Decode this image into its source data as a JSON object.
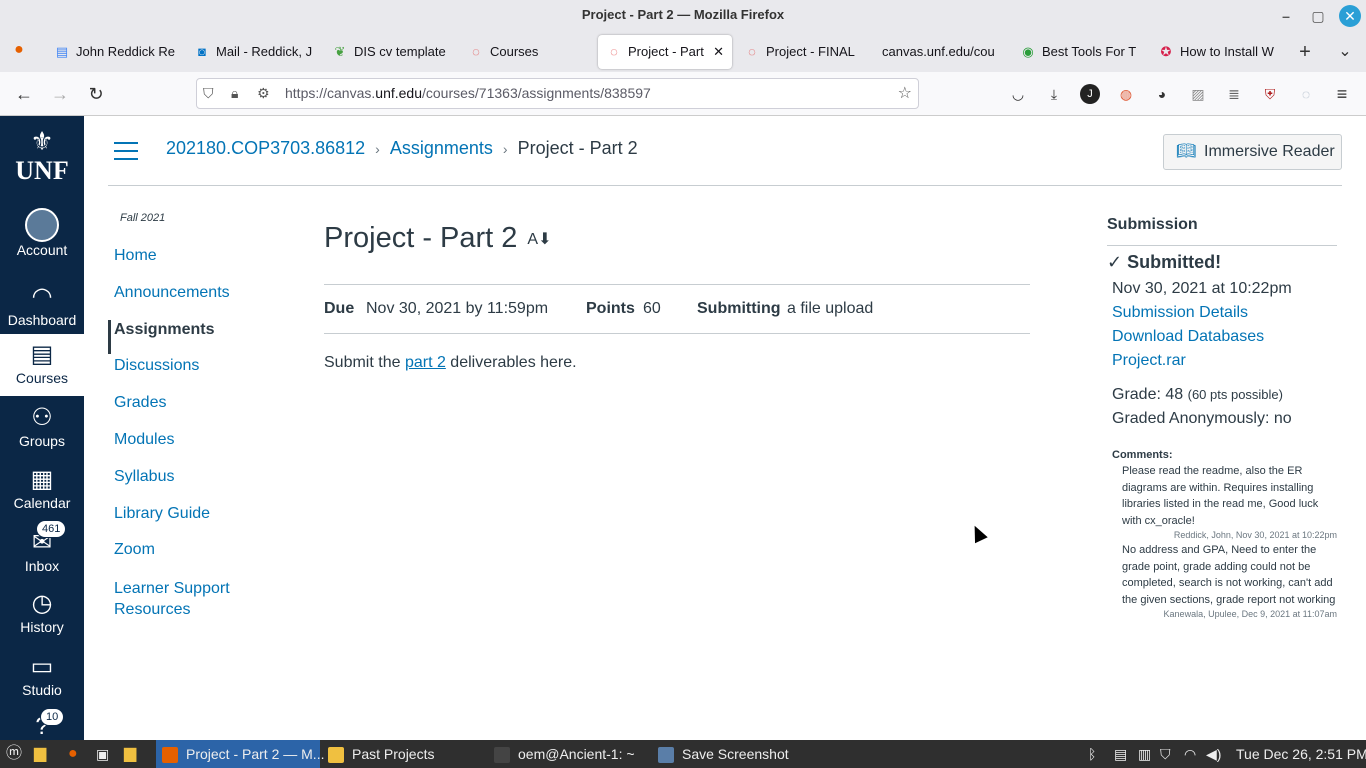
{
  "window": {
    "title": "Project - Part 2 — Mozilla Firefox"
  },
  "tabs": [
    {
      "label": "John Reddick Re",
      "icon": "document-icon"
    },
    {
      "label": "Mail - Reddick, J",
      "icon": "outlook-icon"
    },
    {
      "label": "DIS cv template",
      "icon": "overleaf-icon"
    },
    {
      "label": "Courses",
      "icon": "canvas-icon"
    },
    {
      "label": "Project - Part",
      "icon": "canvas-icon",
      "active": true
    },
    {
      "label": "Project - FINAL",
      "icon": "canvas-icon"
    },
    {
      "label": "canvas.unf.edu/cou",
      "icon": "none"
    },
    {
      "label": "Best Tools For T",
      "icon": "site-icon"
    },
    {
      "label": "How to Install W",
      "icon": "site-icon"
    }
  ],
  "url": {
    "prefix": "https://canvas.",
    "domain": "unf.edu",
    "path": "/courses/71363/assignments/838597"
  },
  "global_nav": {
    "logo": "UNF",
    "items": [
      {
        "label": "Account"
      },
      {
        "label": "Dashboard"
      },
      {
        "label": "Courses"
      },
      {
        "label": "Groups"
      },
      {
        "label": "Calendar"
      },
      {
        "label": "Inbox",
        "badge": "461"
      },
      {
        "label": "History"
      },
      {
        "label": "Studio"
      },
      {
        "label": "",
        "badge": "10"
      }
    ]
  },
  "breadcrumb": {
    "course": "202180.COP3703.86812",
    "section": "Assignments",
    "current": "Project - Part 2"
  },
  "immersive_reader": "Immersive Reader",
  "term": "Fall 2021",
  "course_nav": [
    "Home",
    "Announcements",
    "Assignments",
    "Discussions",
    "Grades",
    "Modules",
    "Syllabus",
    "Library Guide",
    "Zoom",
    "Learner Support",
    "Resources"
  ],
  "assignment": {
    "title": "Project - Part 2",
    "due_label": "Due",
    "due_value": "Nov 30, 2021 by 11:59pm",
    "points_label": "Points",
    "points_value": "60",
    "submitting_label": "Submitting",
    "submitting_value": "a file upload",
    "desc_before": "Submit the ",
    "desc_link": "part 2",
    "desc_after": " deliverables here."
  },
  "submission": {
    "heading": "Submission",
    "status": "Submitted!",
    "date": "Nov 30, 2021 at 10:22pm",
    "details_link": "Submission Details",
    "download_link": "Download Databases",
    "file_link": "Project.rar",
    "grade_label": "Grade: 48",
    "grade_possible": "(60 pts possible)",
    "anon": "Graded Anonymously: no",
    "comments_label": "Comments:",
    "comments": [
      {
        "text": "Please read the readme, also the ER diagrams are within. Requires installing libraries listed in the read me, Good luck with cx_oracle!",
        "author": "Reddick, John, Nov 30, 2021 at 10:22pm"
      },
      {
        "text": "No address and GPA, Need to enter the grade point, grade adding could not be completed, search is not working, can't add the given sections, grade report not working",
        "author": "Kanewala, Upulee, Dec 9, 2021 at 11:07am"
      }
    ]
  },
  "taskbar": {
    "items": [
      "Project - Part 2 — M...",
      "Past Projects",
      "oem@Ancient-1: ~",
      "Save Screenshot"
    ],
    "clock": "Tue Dec 26,  2:51 PM"
  }
}
